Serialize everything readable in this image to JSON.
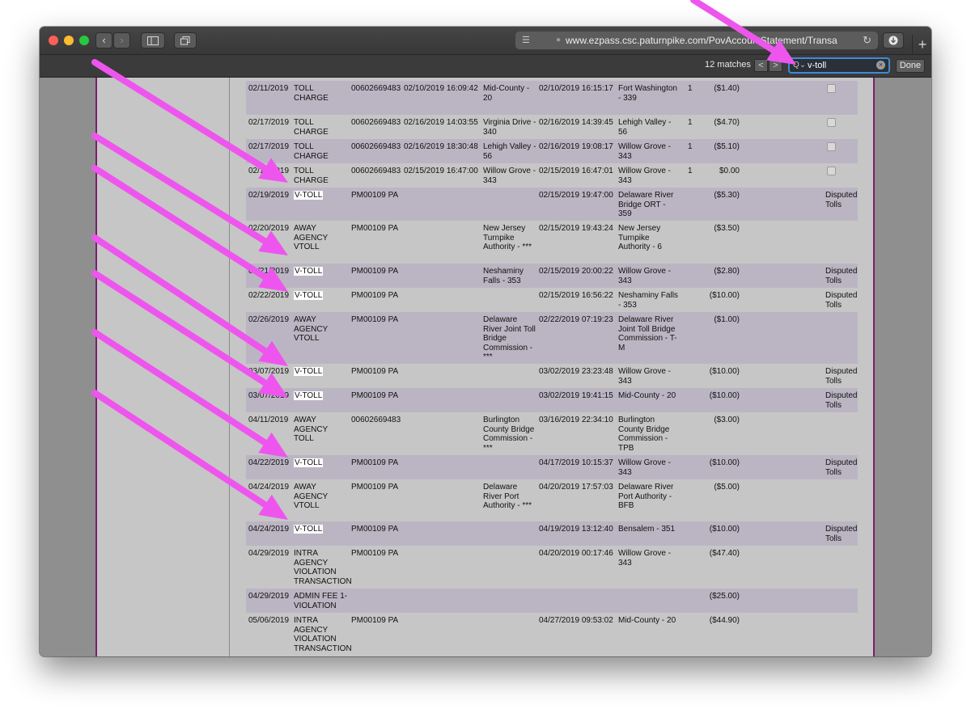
{
  "browser": {
    "url": "www.ezpass.csc.paturnpike.com/PovAccountStatement/Transa",
    "find": {
      "count_label": "12 matches",
      "query": "v-toll",
      "done_label": "Done",
      "prev_label": "<",
      "next_label": ">"
    },
    "accent_color": "#3f8ad8"
  },
  "annotation": {
    "arrow_color": "#ee55ee"
  },
  "transactions": [
    {
      "date": "02/11/2019",
      "type": "TOLL CHARGE",
      "tag": "00602669483",
      "entry_time": "02/10/2019 16:09:42",
      "entry_plaza": "Mid-County - 20",
      "exit_time": "02/10/2019 16:15:17",
      "exit_plaza": "Fort Washington - 339",
      "class": "1",
      "amount": "($1.40)",
      "status": ""
    },
    {
      "date": "02/17/2019",
      "type": "TOLL CHARGE",
      "tag": "00602669483",
      "entry_time": "02/16/2019 14:03:55",
      "entry_plaza": "Virginia Drive - 340",
      "exit_time": "02/16/2019 14:39:45",
      "exit_plaza": "Lehigh Valley - 56",
      "class": "1",
      "amount": "($4.70)",
      "status": ""
    },
    {
      "date": "02/17/2019",
      "type": "TOLL CHARGE",
      "tag": "00602669483",
      "entry_time": "02/16/2019 18:30:48",
      "entry_plaza": "Lehigh Valley - 56",
      "exit_time": "02/16/2019 19:08:17",
      "exit_plaza": "Willow Grove - 343",
      "class": "1",
      "amount": "($5.10)",
      "status": ""
    },
    {
      "date": "02/17/2019",
      "type": "TOLL CHARGE",
      "tag": "00602669483",
      "entry_time": "02/15/2019 16:47:00",
      "entry_plaza": "Willow Grove - 343",
      "exit_time": "02/15/2019 16:47:01",
      "exit_plaza": "Willow Grove - 343",
      "class": "1",
      "amount": "$0.00",
      "status": ""
    },
    {
      "date": "02/19/2019",
      "type": "V-TOLL",
      "tag": "PM00109 PA",
      "entry_time": "",
      "entry_plaza": "",
      "exit_time": "02/15/2019 19:47:00",
      "exit_plaza": "Delaware River Bridge ORT - 359",
      "class": "",
      "amount": "($5.30)",
      "status": "Disputed Tolls"
    },
    {
      "date": "02/20/2019",
      "type": "AWAY AGENCY VTOLL",
      "tag": "PM00109 PA",
      "entry_time": "",
      "entry_plaza": "New Jersey Turnpike Authority - ***",
      "exit_time": "02/15/2019 19:43:24",
      "exit_plaza": "New Jersey Turnpike Authority - 6",
      "class": "",
      "amount": "($3.50)",
      "status": ""
    },
    {
      "date": "02/21/2019",
      "type": "V-TOLL",
      "tag": "PM00109 PA",
      "entry_time": "",
      "entry_plaza": "Neshaminy Falls - 353",
      "exit_time": "02/15/2019 20:00:22",
      "exit_plaza": "Willow Grove - 343",
      "class": "",
      "amount": "($2.80)",
      "status": "Disputed Tolls"
    },
    {
      "date": "02/22/2019",
      "type": "V-TOLL",
      "tag": "PM00109 PA",
      "entry_time": "",
      "entry_plaza": "",
      "exit_time": "02/15/2019 16:56:22",
      "exit_plaza": "Neshaminy Falls - 353",
      "class": "",
      "amount": "($10.00)",
      "status": "Disputed Tolls"
    },
    {
      "date": "02/26/2019",
      "type": "AWAY AGENCY VTOLL",
      "tag": "PM00109 PA",
      "entry_time": "",
      "entry_plaza": "Delaware River Joint Toll Bridge Commission - ***",
      "exit_time": "02/22/2019 07:19:23",
      "exit_plaza": "Delaware River Joint Toll Bridge Commission - T-M",
      "class": "",
      "amount": "($1.00)",
      "status": ""
    },
    {
      "date": "03/07/2019",
      "type": "V-TOLL",
      "tag": "PM00109 PA",
      "entry_time": "",
      "entry_plaza": "",
      "exit_time": "03/02/2019 23:23:48",
      "exit_plaza": "Willow Grove - 343",
      "class": "",
      "amount": "($10.00)",
      "status": "Disputed Tolls"
    },
    {
      "date": "03/07/2019",
      "type": "V-TOLL",
      "tag": "PM00109 PA",
      "entry_time": "",
      "entry_plaza": "",
      "exit_time": "03/02/2019 19:41:15",
      "exit_plaza": "Mid-County - 20",
      "class": "",
      "amount": "($10.00)",
      "status": "Disputed Tolls"
    },
    {
      "date": "04/11/2019",
      "type": "AWAY AGENCY TOLL",
      "tag": "00602669483",
      "entry_time": "",
      "entry_plaza": "Burlington County Bridge Commission - ***",
      "exit_time": "03/16/2019 22:34:10",
      "exit_plaza": "Burlington County Bridge Commission - TPB",
      "class": "",
      "amount": "($3.00)",
      "status": ""
    },
    {
      "date": "04/22/2019",
      "type": "V-TOLL",
      "tag": "PM00109 PA",
      "entry_time": "",
      "entry_plaza": "",
      "exit_time": "04/17/2019 10:15:37",
      "exit_plaza": "Willow Grove - 343",
      "class": "",
      "amount": "($10.00)",
      "status": "Disputed Tolls"
    },
    {
      "date": "04/24/2019",
      "type": "AWAY AGENCY VTOLL",
      "tag": "PM00109 PA",
      "entry_time": "",
      "entry_plaza": "Delaware River Port Authority - ***",
      "exit_time": "04/20/2019 17:57:03",
      "exit_plaza": "Delaware River Port Authority - BFB",
      "class": "",
      "amount": "($5.00)",
      "status": ""
    },
    {
      "date": "04/24/2019",
      "type": "V-TOLL",
      "tag": "PM00109 PA",
      "entry_time": "",
      "entry_plaza": "",
      "exit_time": "04/19/2019 13:12:40",
      "exit_plaza": "Bensalem - 351",
      "class": "",
      "amount": "($10.00)",
      "status": "Disputed Tolls"
    },
    {
      "date": "04/29/2019",
      "type": "INTRA AGENCY VIOLATION TRANSACTION",
      "tag": "PM00109 PA",
      "entry_time": "",
      "entry_plaza": "",
      "exit_time": "04/20/2019 00:17:46",
      "exit_plaza": "Willow Grove - 343",
      "class": "",
      "amount": "($47.40)",
      "status": ""
    },
    {
      "date": "04/29/2019",
      "type": "ADMIN FEE 1-VIOLATION",
      "tag": "",
      "entry_time": "",
      "entry_plaza": "",
      "exit_time": "",
      "exit_plaza": "",
      "class": "",
      "amount": "($25.00)",
      "status": ""
    },
    {
      "date": "05/06/2019",
      "type": "INTRA AGENCY VIOLATION TRANSACTION",
      "tag": "PM00109 PA",
      "entry_time": "",
      "entry_plaza": "",
      "exit_time": "04/27/2019 09:53:02",
      "exit_plaza": "Mid-County - 20",
      "class": "",
      "amount": "($44.90)",
      "status": ""
    }
  ]
}
